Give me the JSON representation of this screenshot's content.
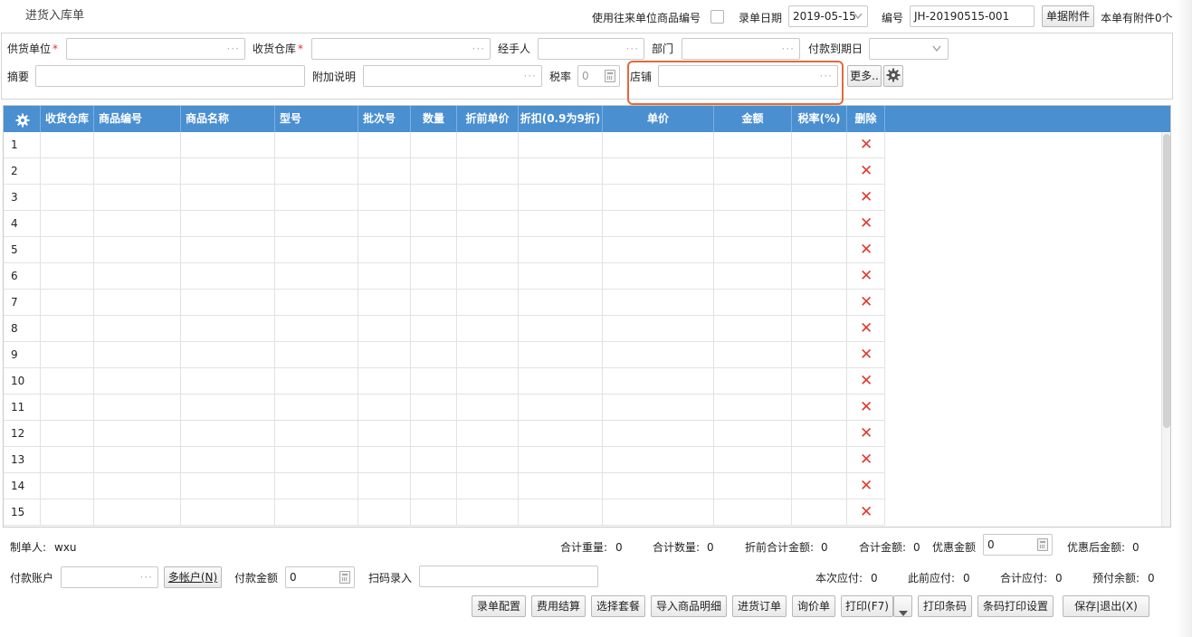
{
  "window_title": "进货入库单",
  "top": {
    "use_partner_code_label": "使用往来单位商品编号",
    "entry_date_label": "录单日期",
    "entry_date_value": "2019-05-15",
    "number_label": "编号",
    "number_value": "JH-20190515-001",
    "attachment_button": "单据附件",
    "attachment_status": "本单有附件0个"
  },
  "form": {
    "supplier_label": "供货单位",
    "warehouse_label": "收货仓库",
    "handler_label": "经手人",
    "department_label": "部门",
    "due_date_label": "付款到期日",
    "summary_label": "摘要",
    "extra_note_label": "附加说明",
    "tax_rate_label": "税率",
    "tax_rate_value": "0",
    "store_label": "店铺",
    "more_button": "更多..",
    "required_mark": "*",
    "dots": "···"
  },
  "grid": {
    "columns": [
      "收货仓库",
      "商品编号",
      "商品名称",
      "型号",
      "批次号",
      "数量",
      "折前单价",
      "折扣(0.9为9折)",
      "单价",
      "金额",
      "税率(%)",
      "删除"
    ],
    "rows": [
      "1",
      "2",
      "3",
      "4",
      "5",
      "6",
      "7",
      "8",
      "9",
      "10",
      "11",
      "12",
      "13",
      "14",
      "15"
    ],
    "delete_glyph": "✕"
  },
  "footer": {
    "maker_label": "制单人:",
    "maker_value": "wxu",
    "total_weight_label": "合计重量:",
    "total_weight_value": "0",
    "total_qty_label": "合计数量:",
    "total_qty_value": "0",
    "pre_discount_total_label": "折前合计金额:",
    "pre_discount_total_value": "0",
    "total_amount_label": "合计金额:",
    "total_amount_value": "0",
    "discount_amount_label": "优惠金额",
    "discount_amount_value": "0",
    "after_discount_label": "优惠后金额:",
    "after_discount_value": "0",
    "pay_account_label": "付款账户",
    "multi_account_button": "多帐户(N)",
    "pay_amount_label": "付款金额",
    "pay_amount_value": "0",
    "scan_label": "扫码录入",
    "current_payable_label": "本次应付:",
    "current_payable_value": "0",
    "previous_payable_label": "此前应付:",
    "previous_payable_value": "0",
    "total_payable_label": "合计应付:",
    "total_payable_value": "0",
    "prepaid_balance_label": "预付余额:",
    "prepaid_balance_value": "0"
  },
  "actions": {
    "entry_config": "录单配置",
    "cost_settlement": "费用结算",
    "select_package": "选择套餐",
    "import_detail": "导入商品明细",
    "purchase_order": "进货订单",
    "inquiry": "询价单",
    "print": "打印(F7)",
    "print_barcode": "打印条码",
    "barcode_print_settings": "条码打印设置",
    "save_exit": "保存|退出(X)"
  },
  "colors": {
    "header_blue": "#4a8fd0",
    "delete_red": "#e03a2f",
    "highlight_orange": "#e36a3a"
  }
}
